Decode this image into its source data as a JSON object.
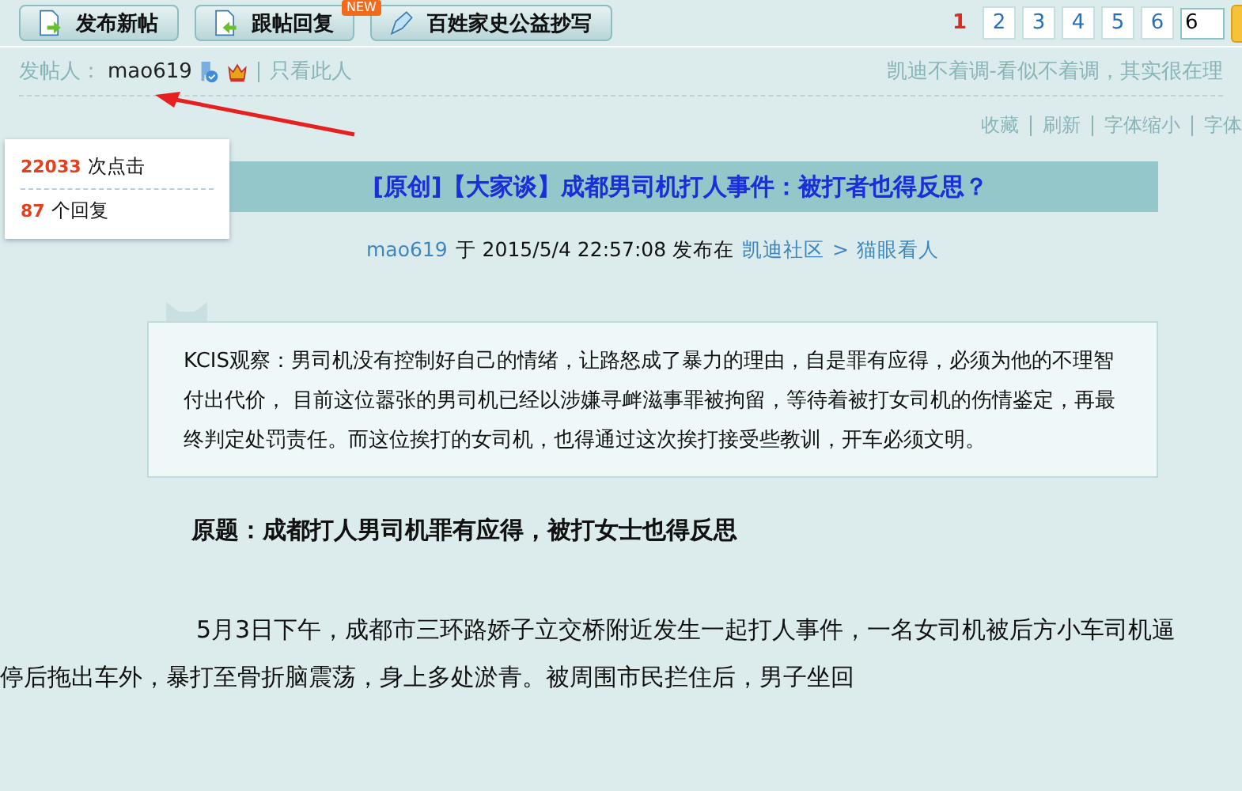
{
  "toolbar": {
    "buttons": [
      {
        "label": "发布新帖",
        "kind": "post"
      },
      {
        "label": "跟帖回复",
        "kind": "reply"
      },
      {
        "label": "百姓家史公益抄写",
        "kind": "pen",
        "badge": "NEW"
      }
    ]
  },
  "pagination": {
    "pages": [
      {
        "label": "1",
        "selected": true
      },
      {
        "label": "2",
        "selected": false
      },
      {
        "label": "3",
        "selected": false
      },
      {
        "label": "4",
        "selected": false
      },
      {
        "label": "5",
        "selected": false
      },
      {
        "label": "6",
        "selected": false
      }
    ],
    "jump_value": "6"
  },
  "author_bar": {
    "label": "发帖人：",
    "author": "mao619",
    "only_this": "只看此人",
    "slogan": "凯迪不着调-看似不着调，其实很在理"
  },
  "tools": [
    "收藏",
    "刷新",
    "字体缩小",
    "字体"
  ],
  "stats": [
    {
      "count": "22033",
      "label": "次点击"
    },
    {
      "count": "87",
      "label": "个回复"
    }
  ],
  "title": "[原创]【大家谈】成都男司机打人事件：被打者也得反思？",
  "meta": {
    "author": "mao619",
    "at": "于 2015/5/4 22:57:08 发布在",
    "forum": "凯迪社区",
    "sep": ">",
    "board": "猫眼看人"
  },
  "summary": "KCIS观察：男司机没有控制好自己的情绪，让路怒成了暴力的理由，自是罪有应得，必须为他的不理智付出代价， 目前这位嚣张的男司机已经以涉嫌寻衅滋事罪被拘留，等待着被打女司机的伤情鉴定，再最终判定处罚责任。而这位挨打的女司机，也得通过这次挨打接受些教训，开车必须文明。",
  "subtitle": "原题：成都打人男司机罪有应得，被打女士也得反思",
  "body": "5月3日下午，成都市三环路娇子立交桥附近发生一起打人事件，一名女司机被后方小车司机逼停后拖出车外，暴打至骨折脑震荡，身上多处淤青。被周围市民拦住后，男子坐回"
}
